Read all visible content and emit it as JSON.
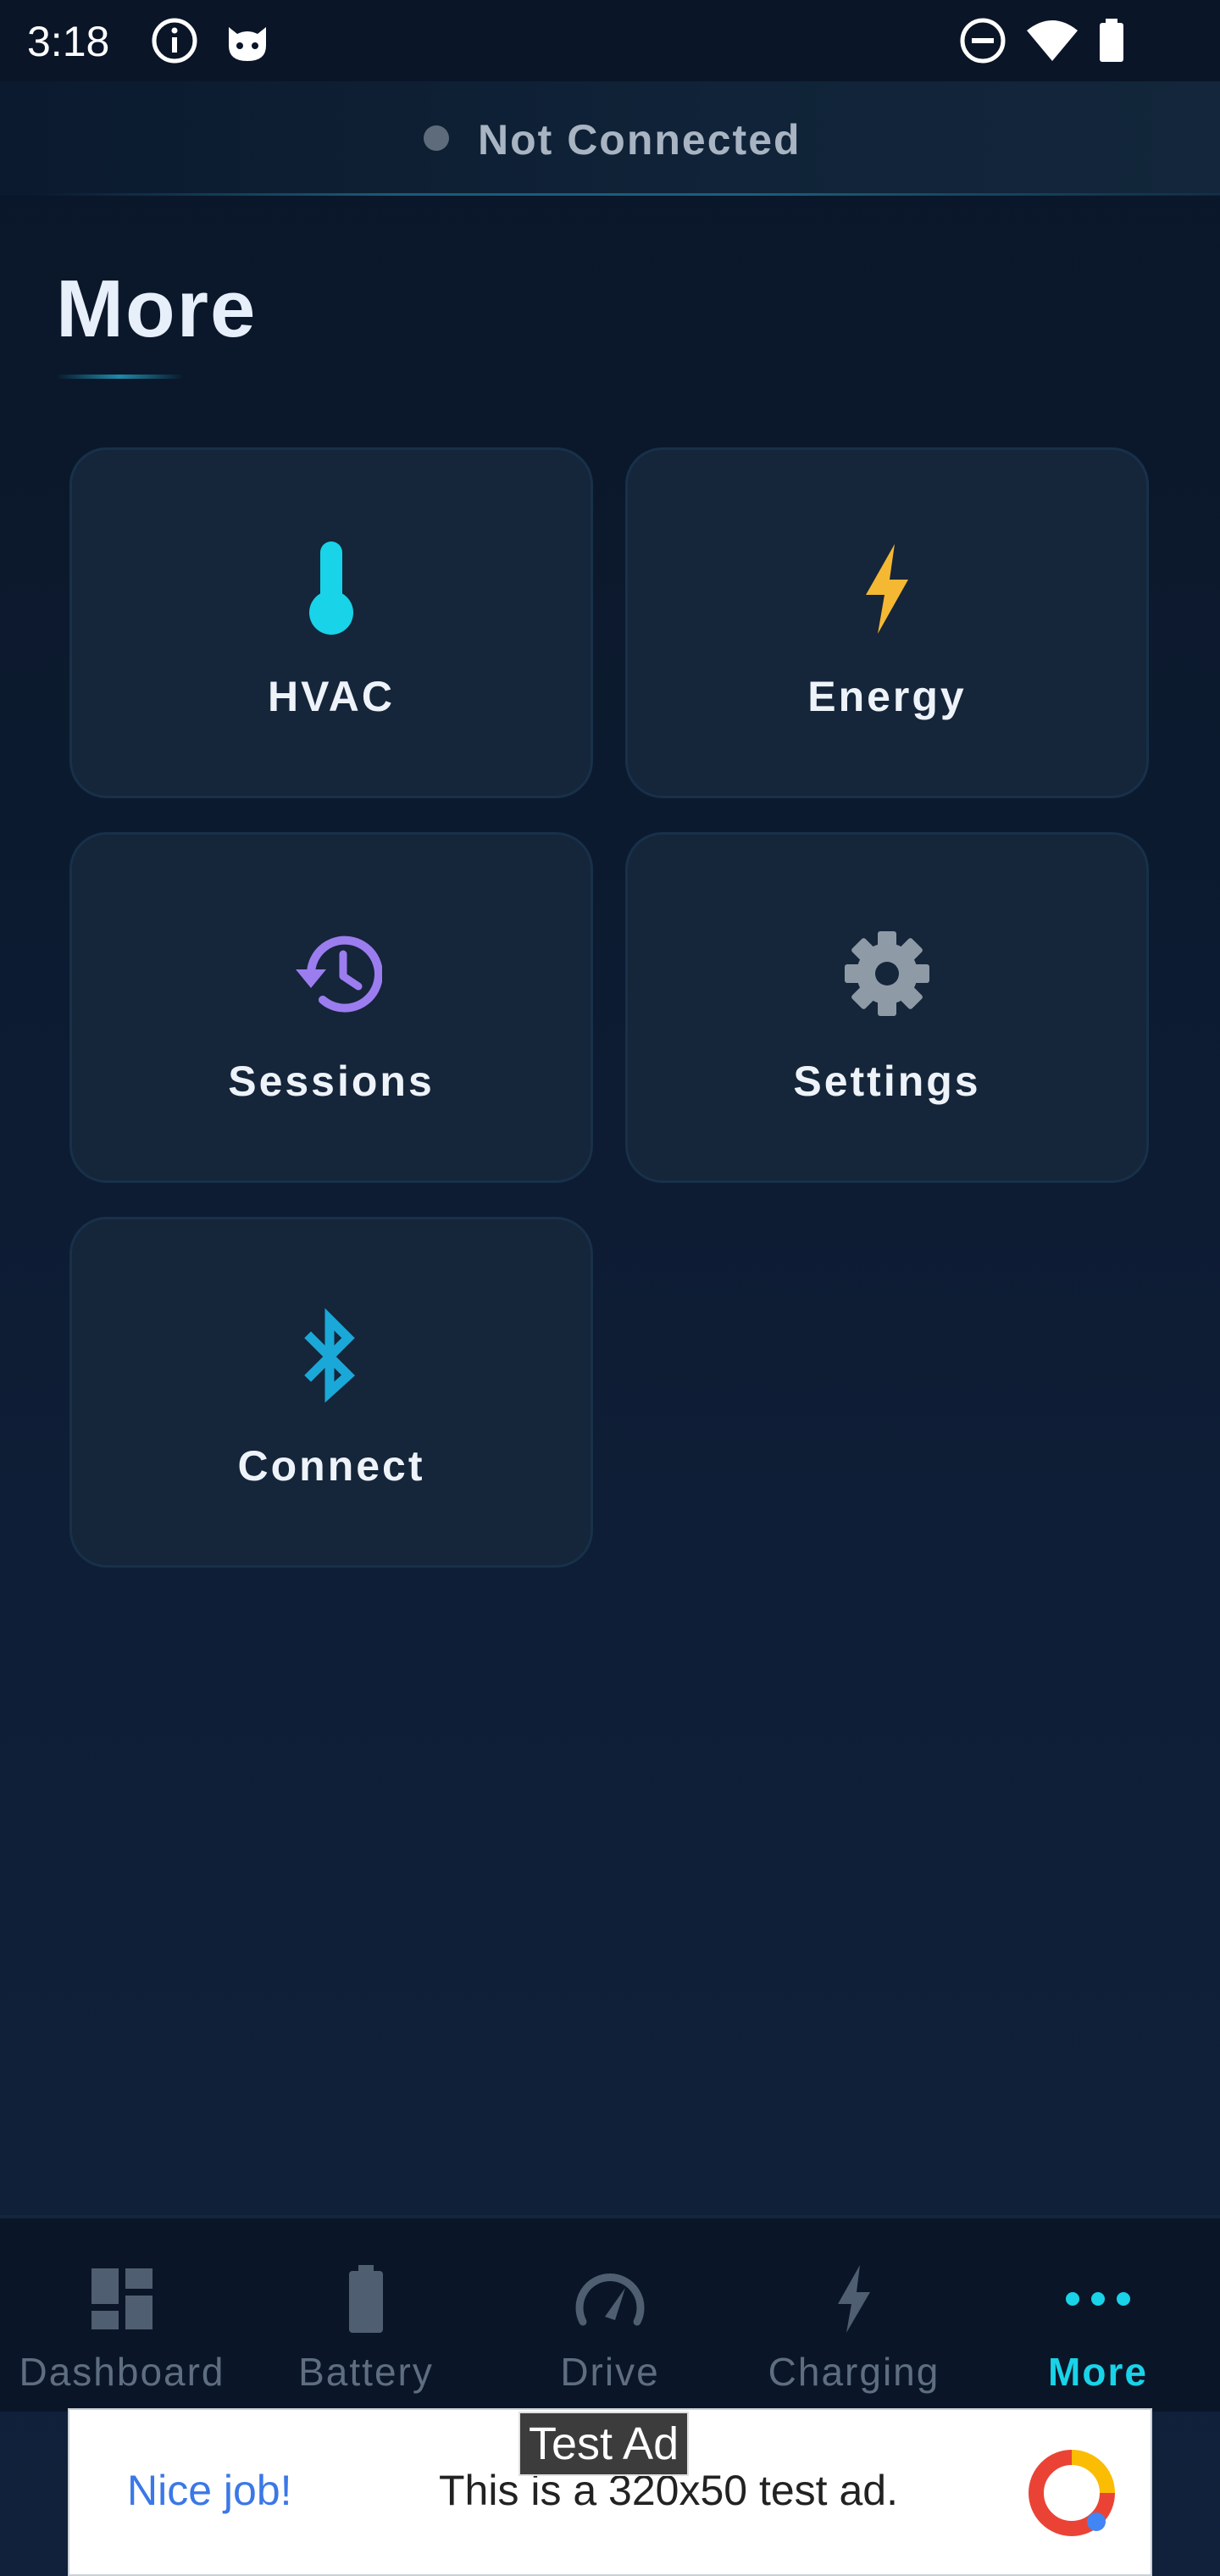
{
  "status_bar": {
    "time": "3:18",
    "icons": [
      "info-icon",
      "cat-face-icon",
      "do-not-disturb-icon",
      "wifi-icon",
      "battery-icon"
    ]
  },
  "connection": {
    "status_text": "Not Connected",
    "dot_color": "#5e6b7a"
  },
  "page": {
    "title": "More"
  },
  "tiles": [
    {
      "label": "HVAC",
      "icon": "thermometer-icon",
      "color": "#19d3e8"
    },
    {
      "label": "Energy",
      "icon": "lightning-bolt-icon",
      "color": "#f5b833"
    },
    {
      "label": "Sessions",
      "icon": "history-clock-icon",
      "color": "#9b7df0"
    },
    {
      "label": "Settings",
      "icon": "gear-icon",
      "color": "#8e9aa6"
    },
    {
      "label": "Connect",
      "icon": "bluetooth-icon",
      "color": "#1aa8d8"
    }
  ],
  "nav": {
    "items": [
      {
        "label": "Dashboard",
        "icon": "dashboard-icon"
      },
      {
        "label": "Battery",
        "icon": "battery-icon"
      },
      {
        "label": "Drive",
        "icon": "speedometer-icon"
      },
      {
        "label": "Charging",
        "icon": "lightning-bolt-icon"
      },
      {
        "label": "More",
        "icon": "more-dots-icon"
      }
    ],
    "active": "More",
    "active_color": "#19d3e8",
    "inactive_color": "#5e6e80"
  },
  "ad": {
    "tag": "Test Ad",
    "headline": "Nice job!",
    "body": "This is a 320x50 test ad."
  }
}
